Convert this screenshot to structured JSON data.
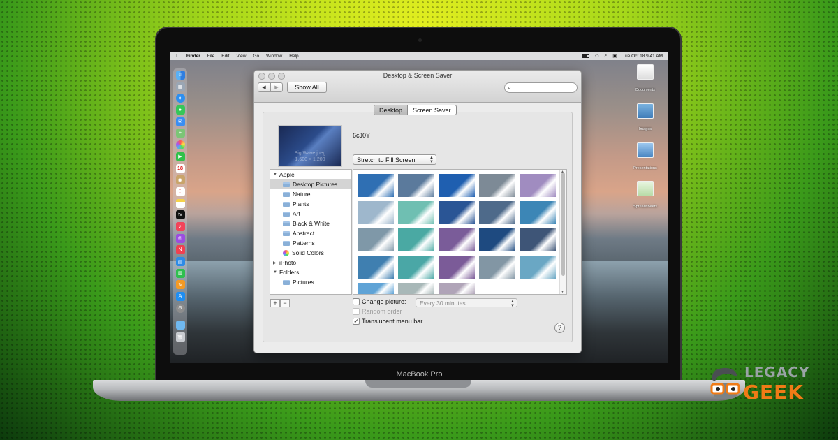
{
  "laptop": {
    "model_label": "MacBook Pro"
  },
  "menubar": {
    "apple_icon": "apple-icon",
    "app_name": "Finder",
    "menus": [
      "File",
      "Edit",
      "View",
      "Go",
      "Window",
      "Help"
    ],
    "clock": "Tue Oct 18  9:41 AM"
  },
  "dock": {
    "items": [
      "finder-icon",
      "launchpad-icon",
      "safari-icon",
      "messages-icon",
      "mail-icon",
      "maps-icon",
      "photos-icon",
      "facetime-icon",
      "calendar-icon",
      "contacts-icon",
      "reminders-icon",
      "notes-icon",
      "tv-icon",
      "music-icon",
      "podcasts-icon",
      "news-icon",
      "keynote-icon",
      "numbers-icon",
      "pages-icon",
      "app-store-icon",
      "system-preferences-icon",
      "folder-icon",
      "trash-icon"
    ],
    "calendar_day": "18"
  },
  "desktop_icons": [
    {
      "label": "Documents"
    },
    {
      "label": "Images"
    },
    {
      "label": "Presentations"
    },
    {
      "label": "Spreadsheets"
    }
  ],
  "window": {
    "title": "Desktop & Screen Saver",
    "show_all": "Show All",
    "search_placeholder": "",
    "tabs": [
      "Desktop",
      "Screen Saver"
    ],
    "active_tab": "Desktop",
    "preview_caption_1": "Big Wave.jpeg",
    "preview_caption_2": "1,600 × 1,200",
    "image_name": "6cJ0Y",
    "fit_option": "Stretch to Fill Screen",
    "sources": [
      {
        "label": "Apple",
        "type": "group"
      },
      {
        "label": "Desktop Pictures",
        "type": "folder",
        "selected": true
      },
      {
        "label": "Nature",
        "type": "folder"
      },
      {
        "label": "Plants",
        "type": "folder"
      },
      {
        "label": "Art",
        "type": "folder"
      },
      {
        "label": "Black & White",
        "type": "folder"
      },
      {
        "label": "Abstract",
        "type": "folder"
      },
      {
        "label": "Patterns",
        "type": "folder"
      },
      {
        "label": "Solid Colors",
        "type": "colors"
      },
      {
        "label": "iPhoto",
        "type": "group-collapsed"
      },
      {
        "label": "Folders",
        "type": "group"
      },
      {
        "label": "Pictures",
        "type": "folder"
      }
    ],
    "add_label": "+",
    "remove_label": "−",
    "change_picture_label": "Change picture:",
    "change_picture_checked": false,
    "interval": "Every 30 minutes",
    "random_order_label": "Random order",
    "random_order_checked": false,
    "translucent_label": "Translucent menu bar",
    "translucent_checked": true,
    "translucent_mark": "✓",
    "help_label": "?",
    "thumbnail_colors": [
      "#2f6fb3",
      "#5b7a9c",
      "#1f5fb0",
      "#7d8a96",
      "#a08cc0",
      "#9eb7cc",
      "#6fbfb2",
      "#2a5595",
      "#4e6a8a",
      "#3c86b6",
      "#7f98a8",
      "#4aa9a3",
      "#7a5c99",
      "#1e4a80",
      "#3e5577",
      "#3f7fb0",
      "#4aa7a6",
      "#7b5b98",
      "#8296a4",
      "#6aa7c4",
      "#5fa3d6",
      "#a8b8b8",
      "#b0a4b8"
    ]
  },
  "brand": {
    "line1": "LEGACY",
    "line2": "GEEK"
  }
}
